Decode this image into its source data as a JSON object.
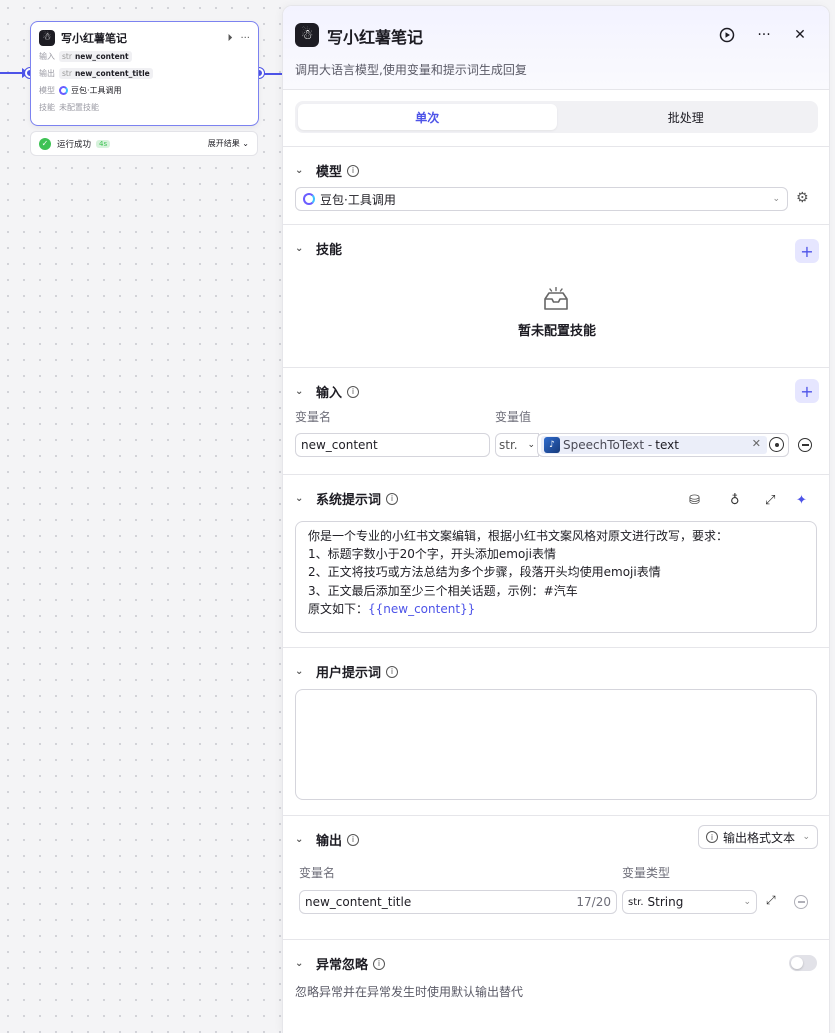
{
  "node": {
    "title": "写小红薯笔记",
    "input_label": "输入",
    "input_type": "str",
    "input_value": "new_content",
    "output_label": "输出",
    "output_type": "str",
    "output_value": "new_content_title",
    "model_label": "模型",
    "model_value": "豆包·工具调用",
    "skill_label": "技能",
    "skill_value": "未配置技能",
    "status_text": "运行成功",
    "status_time": "4s",
    "expand_label": "展开结果"
  },
  "panel": {
    "title": "写小红薯笔记",
    "description": "调用大语言模型,使用变量和提示词生成回复",
    "tabs": [
      "单次",
      "批处理"
    ],
    "active_tab": 0,
    "model": {
      "label": "模型",
      "selected": "豆包·工具调用"
    },
    "skills": {
      "label": "技能",
      "empty_text": "暂未配置技能"
    },
    "inputs": {
      "label": "输入",
      "col_name": "变量名",
      "col_value": "变量值",
      "rows": [
        {
          "name": "new_content",
          "type": "str.",
          "source": "SpeechToText - ",
          "field": "text"
        }
      ]
    },
    "system_prompt": {
      "label": "系统提示词",
      "lines": [
        "你是一个专业的小红书文案编辑，根据小红书文案风格对原文进行改写，要求：",
        "1、标题字数小于20个字，开头添加emoji表情",
        "2、正文将技巧或方法总结为多个步骤，段落开头均使用emoji表情",
        "3、正文最后添加至少三个相关话题，示例：#汽车"
      ],
      "last_line_prefix": "原文如下：",
      "last_line_var": "{{new_content}}"
    },
    "user_prompt": {
      "label": "用户提示词",
      "content": ""
    },
    "outputs": {
      "label": "输出",
      "format": "输出格式文本",
      "col_name": "变量名",
      "col_type": "变量类型",
      "rows": [
        {
          "name": "new_content_title",
          "count": "17/20",
          "type_prefix": "str.",
          "type": "String"
        }
      ]
    },
    "exception": {
      "label": "异常忽略",
      "description": "忽略异常并在异常发生时使用默认输出替代",
      "enabled": false
    }
  },
  "icons": {
    "logo": "notebook-logo-icon",
    "run": "play-icon",
    "more": "more-icon",
    "close": "close-icon",
    "settings": "gear-icon",
    "add": "plus-icon"
  }
}
